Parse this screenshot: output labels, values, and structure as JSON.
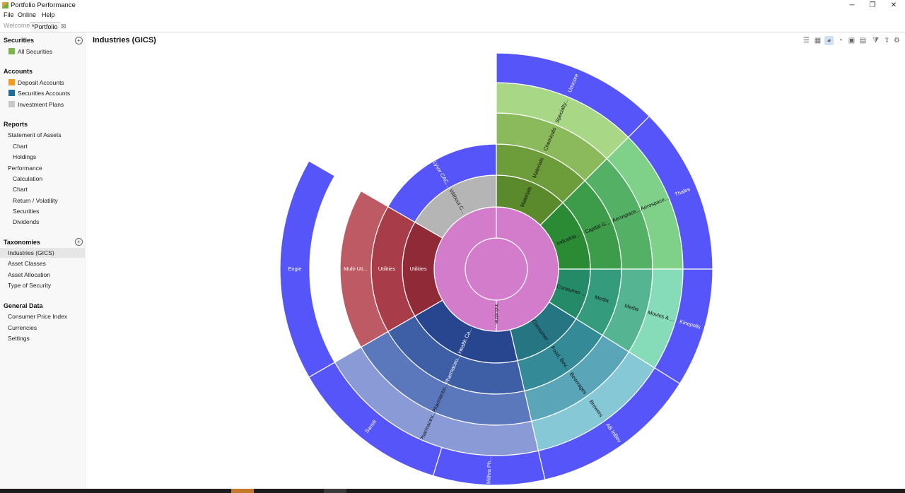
{
  "window": {
    "title": "Portfolio Performance"
  },
  "menu": [
    "File",
    "Online",
    "Help"
  ],
  "tabs": {
    "welcome": "Welcome",
    "portfolio": "*Portfolio"
  },
  "sidebar": {
    "securities": {
      "header": "Securities",
      "items": [
        "All Securities"
      ]
    },
    "accounts": {
      "header": "Accounts",
      "items": [
        "Deposit Accounts",
        "Securities Accounts",
        "Investment Plans"
      ]
    },
    "reports": {
      "header": "Reports",
      "items": [
        "Statement of Assets",
        "Chart",
        "Holdings",
        "Performance",
        "Calculation",
        "Chart",
        "Return / Volatility",
        "Securities",
        "Dividends"
      ]
    },
    "taxonomies": {
      "header": "Taxonomies",
      "items": [
        "Industries (GICS)",
        "Asset Classes",
        "Asset Allocation",
        "Type of Security"
      ]
    },
    "general": {
      "header": "General Data",
      "items": [
        "Consumer Price Index",
        "Currencies",
        "Settings"
      ]
    }
  },
  "colors": {
    "deposit": "#f39a1e",
    "securities_accounts": "#1e6e9c",
    "investment_plans": "#c8c8c8",
    "all_securities": "#7ab648",
    "selected": "#e6e6e6"
  },
  "page": {
    "title": "Industries (GICS)"
  },
  "toolbar_icons": [
    "list-icon",
    "treemap-icon",
    "sunburst-icon",
    "pie-icon",
    "grid-icon",
    "stacked-area-icon",
    "filter-icon",
    "export-icon",
    "gear-icon"
  ],
  "chart_data": {
    "type": "sunburst",
    "root": {
      "label": "Industries (GICS)",
      "color": "#d37ccc"
    },
    "inner_ring": [
      {
        "label": "Industrie...",
        "start": 0,
        "end": 360,
        "color": "#d37ccc"
      }
    ],
    "sectors": [
      {
        "label": "Materials",
        "start": 0,
        "end": 45,
        "color": "#5a8a2b"
      },
      {
        "label": "Industria...",
        "start": 45,
        "end": 90,
        "color": "#2b8a34"
      },
      {
        "label": "Consumer ...",
        "start": 90,
        "end": 122,
        "color": "#258a68"
      },
      {
        "label": "Consumer ...",
        "start": 122,
        "end": 167,
        "color": "#267582"
      },
      {
        "label": "Health Ca...",
        "start": 167,
        "end": 240,
        "color": "#284690"
      },
      {
        "label": "Utilities",
        "start": 240,
        "end": 300,
        "color": "#902a36"
      },
      {
        "label": "Without C...",
        "start": 300,
        "end": 360,
        "color": "#b5b5b5"
      }
    ],
    "industry_groups": [
      {
        "label": "Materials",
        "start": 0,
        "end": 45,
        "color": "#6d9c3a"
      },
      {
        "label": "Capital G...",
        "start": 45,
        "end": 90,
        "color": "#3c9c4a"
      },
      {
        "label": "Media",
        "start": 90,
        "end": 122,
        "color": "#349c7c"
      },
      {
        "label": "Food, Bev...",
        "start": 122,
        "end": 167,
        "color": "#348a96"
      },
      {
        "label": "Pharmaceu...",
        "start": 167,
        "end": 240,
        "color": "#3e5ea6"
      },
      {
        "label": "Utilities",
        "start": 240,
        "end": 300,
        "color": "#a83c48"
      },
      {
        "label": "Lyxor CAC...",
        "start": 300,
        "end": 360,
        "color": "#5555fa",
        "leaf": true
      }
    ],
    "industries": [
      {
        "label": "Chemicals",
        "start": 0,
        "end": 45,
        "color": "#8aba5c"
      },
      {
        "label": "Aerospace...",
        "start": 45,
        "end": 90,
        "color": "#54b065"
      },
      {
        "label": "Media",
        "start": 90,
        "end": 122,
        "color": "#55b592"
      },
      {
        "label": "Beverages",
        "start": 122,
        "end": 167,
        "color": "#5aa6b8"
      },
      {
        "label": "Pharmaceu...",
        "start": 167,
        "end": 240,
        "color": "#5c78bc"
      },
      {
        "label": "Multi-Uti...",
        "start": 240,
        "end": 300,
        "color": "#bd5a63"
      }
    ],
    "sub_industries": [
      {
        "label": "Specialty...",
        "start": 0,
        "end": 45,
        "color": "#a8d886"
      },
      {
        "label": "Aerospace...",
        "start": 45,
        "end": 90,
        "color": "#7fd18a"
      },
      {
        "label": "Movies & ...",
        "start": 90,
        "end": 122,
        "color": "#86dbb9"
      },
      {
        "label": "Brewers",
        "start": 122,
        "end": 167,
        "color": "#86c8d6"
      },
      {
        "label": "Pharmaceu...",
        "start": 167,
        "end": 240,
        "color": "#8a9ad6"
      }
    ],
    "securities": [
      {
        "label": "Umicore",
        "start": 0,
        "end": 45,
        "color": "#5555fa"
      },
      {
        "label": "Thales",
        "start": 45,
        "end": 90,
        "color": "#5555fa"
      },
      {
        "label": "Kinepolis",
        "start": 90,
        "end": 122,
        "color": "#5555fa"
      },
      {
        "label": "AB InBev",
        "start": 122,
        "end": 167,
        "color": "#5555fa"
      },
      {
        "label": "Mithra Ph...",
        "start": 167,
        "end": 197,
        "color": "#5555fa"
      },
      {
        "label": "Sanofi",
        "start": 197,
        "end": 240,
        "color": "#5555fa"
      },
      {
        "label": "Engie",
        "start": 240,
        "end": 300,
        "color": "#5555fa"
      }
    ]
  }
}
